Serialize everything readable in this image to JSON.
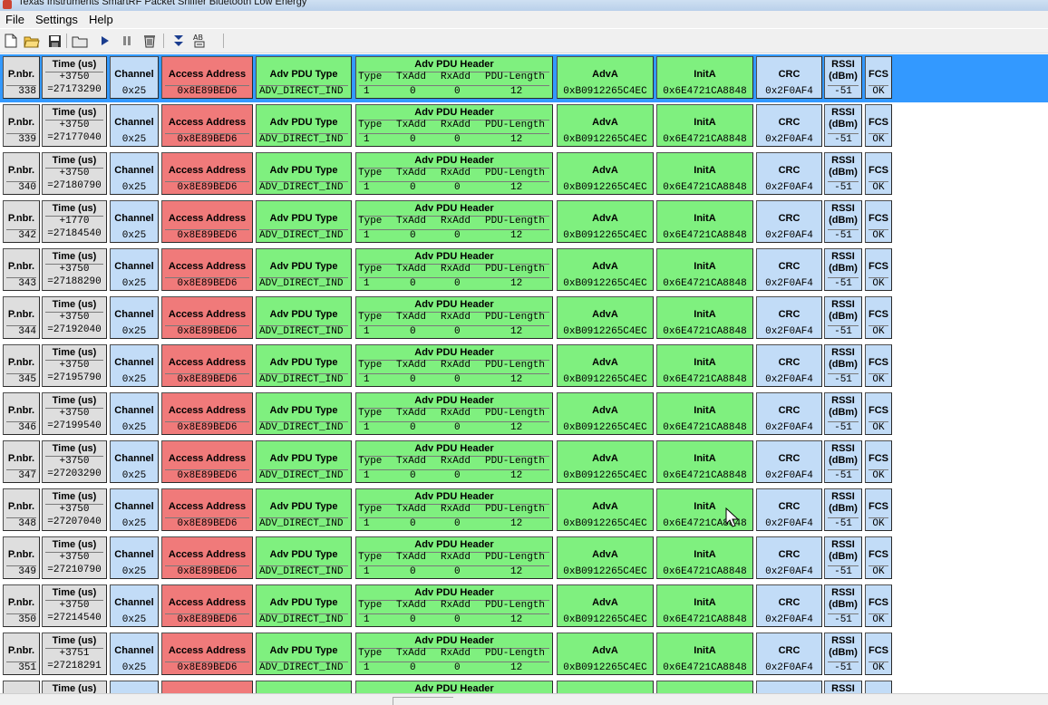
{
  "window": {
    "title": "Texas Instruments SmartRF Packet Sniffer Bluetooth Low Energy"
  },
  "menu": [
    {
      "id": "file",
      "label": "File"
    },
    {
      "id": "settings",
      "label": "Settings"
    },
    {
      "id": "help",
      "label": "Help"
    }
  ],
  "toolbar": [
    {
      "icon": "new-file-icon"
    },
    {
      "icon": "open-folder-icon"
    },
    {
      "icon": "save-icon"
    },
    {
      "icon": "folder-icon"
    },
    {
      "icon": "play-icon"
    },
    {
      "icon": "pause-icon"
    },
    {
      "icon": "clear-icon"
    },
    {
      "icon": "scroll-down-icon"
    },
    {
      "icon": "text-format-icon"
    }
  ],
  "headers": {
    "pnbr": "P.nbr.",
    "time": "Time (us)",
    "channel": "Channel",
    "access_address": "Access Address",
    "adv_pdu_type": "Adv PDU Type",
    "adv_pdu_header": "Adv PDU Header",
    "hdr_type": "Type",
    "hdr_txadd": "TxAdd",
    "hdr_rxadd": "RxAdd",
    "hdr_pdu_length": "PDU-Length",
    "adva": "AdvA",
    "inita": "InitA",
    "crc": "CRC",
    "rssi_1": "RSSI",
    "rssi_2": "(dBm)",
    "fcs": "FCS"
  },
  "packets": [
    {
      "pnbr": "338",
      "delta": "+3750",
      "time": "=27173290",
      "channel": "0x25",
      "access_address": "0x8E89BED6",
      "pdu_type": "ADV_DIRECT_IND",
      "type": "1",
      "txadd": "0",
      "rxadd": "0",
      "pdu_length": "12",
      "adva": "0xB0912265C4EC",
      "inita": "0x6E4721CA8848",
      "crc": "0x2F0AF4",
      "rssi": "-51",
      "fcs": "OK",
      "selected": true
    },
    {
      "pnbr": "339",
      "delta": "+3750",
      "time": "=27177040",
      "channel": "0x25",
      "access_address": "0x8E89BED6",
      "pdu_type": "ADV_DIRECT_IND",
      "type": "1",
      "txadd": "0",
      "rxadd": "0",
      "pdu_length": "12",
      "adva": "0xB0912265C4EC",
      "inita": "0x6E4721CA8848",
      "crc": "0x2F0AF4",
      "rssi": "-51",
      "fcs": "OK"
    },
    {
      "pnbr": "340",
      "delta": "+3750",
      "time": "=27180790",
      "channel": "0x25",
      "access_address": "0x8E89BED6",
      "pdu_type": "ADV_DIRECT_IND",
      "type": "1",
      "txadd": "0",
      "rxadd": "0",
      "pdu_length": "12",
      "adva": "0xB0912265C4EC",
      "inita": "0x6E4721CA8848",
      "crc": "0x2F0AF4",
      "rssi": "-51",
      "fcs": "OK"
    },
    {
      "pnbr": "342",
      "delta": "+1770",
      "time": "=27184540",
      "channel": "0x25",
      "access_address": "0x8E89BED6",
      "pdu_type": "ADV_DIRECT_IND",
      "type": "1",
      "txadd": "0",
      "rxadd": "0",
      "pdu_length": "12",
      "adva": "0xB0912265C4EC",
      "inita": "0x6E4721CA8848",
      "crc": "0x2F0AF4",
      "rssi": "-51",
      "fcs": "OK"
    },
    {
      "pnbr": "343",
      "delta": "+3750",
      "time": "=27188290",
      "channel": "0x25",
      "access_address": "0x8E89BED6",
      "pdu_type": "ADV_DIRECT_IND",
      "type": "1",
      "txadd": "0",
      "rxadd": "0",
      "pdu_length": "12",
      "adva": "0xB0912265C4EC",
      "inita": "0x6E4721CA8848",
      "crc": "0x2F0AF4",
      "rssi": "-51",
      "fcs": "OK"
    },
    {
      "pnbr": "344",
      "delta": "+3750",
      "time": "=27192040",
      "channel": "0x25",
      "access_address": "0x8E89BED6",
      "pdu_type": "ADV_DIRECT_IND",
      "type": "1",
      "txadd": "0",
      "rxadd": "0",
      "pdu_length": "12",
      "adva": "0xB0912265C4EC",
      "inita": "0x6E4721CA8848",
      "crc": "0x2F0AF4",
      "rssi": "-51",
      "fcs": "OK"
    },
    {
      "pnbr": "345",
      "delta": "+3750",
      "time": "=27195790",
      "channel": "0x25",
      "access_address": "0x8E89BED6",
      "pdu_type": "ADV_DIRECT_IND",
      "type": "1",
      "txadd": "0",
      "rxadd": "0",
      "pdu_length": "12",
      "adva": "0xB0912265C4EC",
      "inita": "0x6E4721CA8848",
      "crc": "0x2F0AF4",
      "rssi": "-51",
      "fcs": "OK"
    },
    {
      "pnbr": "346",
      "delta": "+3750",
      "time": "=27199540",
      "channel": "0x25",
      "access_address": "0x8E89BED6",
      "pdu_type": "ADV_DIRECT_IND",
      "type": "1",
      "txadd": "0",
      "rxadd": "0",
      "pdu_length": "12",
      "adva": "0xB0912265C4EC",
      "inita": "0x6E4721CA8848",
      "crc": "0x2F0AF4",
      "rssi": "-51",
      "fcs": "OK"
    },
    {
      "pnbr": "347",
      "delta": "+3750",
      "time": "=27203290",
      "channel": "0x25",
      "access_address": "0x8E89BED6",
      "pdu_type": "ADV_DIRECT_IND",
      "type": "1",
      "txadd": "0",
      "rxadd": "0",
      "pdu_length": "12",
      "adva": "0xB0912265C4EC",
      "inita": "0x6E4721CA8848",
      "crc": "0x2F0AF4",
      "rssi": "-51",
      "fcs": "OK"
    },
    {
      "pnbr": "348",
      "delta": "+3750",
      "time": "=27207040",
      "channel": "0x25",
      "access_address": "0x8E89BED6",
      "pdu_type": "ADV_DIRECT_IND",
      "type": "1",
      "txadd": "0",
      "rxadd": "0",
      "pdu_length": "12",
      "adva": "0xB0912265C4EC",
      "inita": "0x6E4721CA8848",
      "crc": "0x2F0AF4",
      "rssi": "-51",
      "fcs": "OK"
    },
    {
      "pnbr": "349",
      "delta": "+3750",
      "time": "=27210790",
      "channel": "0x25",
      "access_address": "0x8E89BED6",
      "pdu_type": "ADV_DIRECT_IND",
      "type": "1",
      "txadd": "0",
      "rxadd": "0",
      "pdu_length": "12",
      "adva": "0xB0912265C4EC",
      "inita": "0x6E4721CA8848",
      "crc": "0x2F0AF4",
      "rssi": "-51",
      "fcs": "OK"
    },
    {
      "pnbr": "350",
      "delta": "+3750",
      "time": "=27214540",
      "channel": "0x25",
      "access_address": "0x8E89BED6",
      "pdu_type": "ADV_DIRECT_IND",
      "type": "1",
      "txadd": "0",
      "rxadd": "0",
      "pdu_length": "12",
      "adva": "0xB0912265C4EC",
      "inita": "0x6E4721CA8848",
      "crc": "0x2F0AF4",
      "rssi": "-51",
      "fcs": "OK"
    },
    {
      "pnbr": "351",
      "delta": "+3751",
      "time": "=27218291",
      "channel": "0x25",
      "access_address": "0x8E89BED6",
      "pdu_type": "ADV_DIRECT_IND",
      "type": "1",
      "txadd": "0",
      "rxadd": "0",
      "pdu_length": "12",
      "adva": "0xB0912265C4EC",
      "inita": "0x6E4721CA8848",
      "crc": "0x2F0AF4",
      "rssi": "-51",
      "fcs": "OK"
    },
    {
      "pnbr": "",
      "delta": "",
      "time": "",
      "channel": "",
      "access_address": "",
      "pdu_type": "",
      "type": "",
      "txadd": "",
      "rxadd": "",
      "pdu_length": "",
      "adva": "",
      "inita": "",
      "crc": "",
      "rssi": "",
      "fcs": ""
    }
  ],
  "colors": {
    "selection": "#3399ff",
    "gray_cell": "#dedede",
    "blue_cell": "#c2dcf7",
    "red_cell": "#f07a7a",
    "green_cell": "#7ff07f"
  }
}
